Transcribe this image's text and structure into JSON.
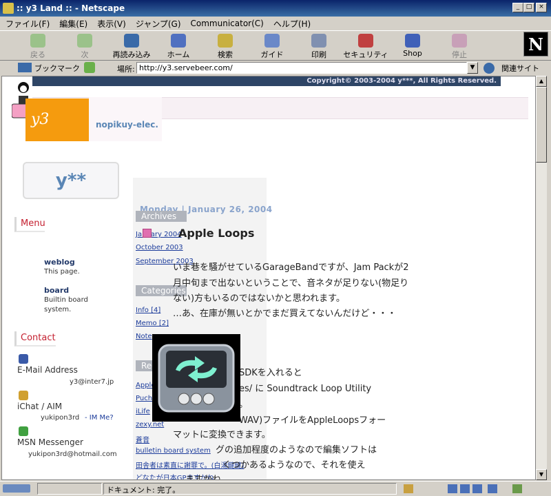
{
  "window": {
    "title": ":: y3 Land :: - Netscape"
  },
  "menu": [
    "ファイル(F)",
    "編集(E)",
    "表示(V)",
    "ジャンプ(G)",
    "Communicator(C)",
    "ヘルプ(H)"
  ],
  "toolbar": [
    {
      "label": "戻る",
      "icon": "back-arrow-icon",
      "enabled": false
    },
    {
      "label": "次",
      "icon": "forward-arrow-icon",
      "enabled": false
    },
    {
      "label": "再読み込み",
      "icon": "reload-icon",
      "enabled": true
    },
    {
      "label": "ホーム",
      "icon": "home-icon",
      "enabled": true
    },
    {
      "label": "検索",
      "icon": "search-icon",
      "enabled": true
    },
    {
      "label": "ガイド",
      "icon": "guide-icon",
      "enabled": true
    },
    {
      "label": "印刷",
      "icon": "print-icon",
      "enabled": true
    },
    {
      "label": "セキュリティ",
      "icon": "security-lock-icon",
      "enabled": true
    },
    {
      "label": "Shop",
      "icon": "shop-icon",
      "enabled": true
    },
    {
      "label": "停止",
      "icon": "stop-icon",
      "enabled": false
    }
  ],
  "location": {
    "bookmarks_label": "ブックマーク",
    "location_label": "場所:",
    "url": "http://y3.servebeer.com/",
    "related_label": "関連サイト"
  },
  "page": {
    "copyright": "Copyright© 2003-2004 y***, All Rights Reserved.",
    "logo_text": "y3 Land",
    "tagline": "nopikuy-elec.",
    "ybox_text": "y**",
    "menu_head": "Menu",
    "menu_items": [
      {
        "title": "weblog",
        "desc": [
          "This page."
        ]
      },
      {
        "title": "board",
        "desc": [
          "Builtin board",
          "system."
        ]
      }
    ],
    "contact_head": "Contact",
    "contacts": [
      {
        "name": "E-Mail Address",
        "value": "y3@inter7.jp",
        "extra": ""
      },
      {
        "name": "iChat / AIM",
        "value": "yukipon3rd",
        "extra": "- IM Me?"
      },
      {
        "name": "MSN Messenger",
        "value": "yukipon3rd@hotmail.com",
        "extra": ""
      }
    ],
    "date_heading": "Monday | January 26, 2004",
    "post_title": "Apple Loops",
    "archives_head": "Archives",
    "archives": [
      "January 2004",
      "October 2003",
      "September 2003"
    ],
    "categories_head": "Categories",
    "categories": [
      "Info [4]",
      "Memo [2]",
      "Note"
    ],
    "recent_head": "Recent",
    "recent_links": [
      "Apple",
      "Puch",
      "iLife",
      "zexy.net",
      "蒼音",
      "bulletin board system",
      "田舎者は素直に謝罪で。(白湯鍵鍵)",
      "どなたが日本GPますかね"
    ],
    "body_lines": [
      "いま巷を騒がせているGarageBandですが、Jam Packが2",
      "月中旬まで出ないということで、音ネタが足りない(物足り",
      "ない)方もいるのではないかと思われます。",
      "…あ、在庫が無いとかでまだ買えてないんだけど・・・",
      "SDKを入れると",
      "es/ に Soundtrack Loop Utility",
      "。",
      "WAV)ファイルをAppleLoopsフォー",
      "マットに変換できます。",
      "グの追加程度のようなので編集ソフトは",
      "くつかあるようなので、それを使え",
      "ますかね"
    ]
  },
  "status": {
    "text": "ドキュメント: 完了。"
  }
}
